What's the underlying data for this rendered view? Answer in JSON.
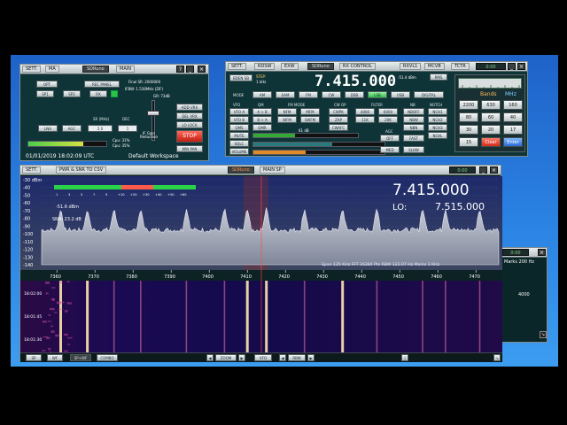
{
  "main_win": {
    "sett": "SETT.",
    "ma": "MA",
    "title": "SDRuno",
    "tab": "MAIN",
    "opt": "OPT",
    "rec_panel": "REC PANEL",
    "sp1": "SP1",
    "sp2": "SP2",
    "rx": "RX",
    "final_sr": "Final SR: 2000000",
    "ifbw": "IFBW: 1.536MHz (ZIF)",
    "gr": "GR: 73dB",
    "add_vrx": "ADD VRX",
    "del_vrx": "DEL VRX",
    "lo_lock": "LO LOCK",
    "stop": "STOP",
    "min_pan": "MIN PAN",
    "lna": "LNA",
    "agc": "AGC",
    "sr_label": "SR (MHz)",
    "sr_value": "2.0",
    "dec_label": "DEC",
    "dec_value": "1",
    "if_gain": "IF Gain Reduction",
    "cpu1": "Cpu: 31%",
    "cpu2": "Cpu: 35%",
    "datetime": "01/01/2019 18:02:09 UTC",
    "workspace": "Default Workspace"
  },
  "rx_win": {
    "sett": "SETT.",
    "rdsw": "RDSW",
    "exw": "EXW",
    "title": "SDRuno",
    "tab": "RX CONTROL",
    "rxvl": "RXVL1",
    "mcv": "MCVB",
    "tctr": "TCTR",
    "band_sel": "BDEN SB",
    "step_label": "STEP:",
    "step_value": "1 kHz",
    "frequency": "7.415.000",
    "signal_db": "-51.4 dBm",
    "rms": "RMS",
    "mode_label": "MODE",
    "modes": [
      "AM",
      "SAM",
      "FM",
      "CW",
      "DSB",
      "LSB",
      "USB",
      "DIGITAL"
    ],
    "vfo_label": "VFO",
    "qm_label": "QM",
    "fm_mode_label": "FM MODE",
    "cw_op_label": "CW OP",
    "filter_label": "FILTER",
    "nb_label": "NB",
    "notch_label": "NOTCH",
    "vfo_a": "VFO A",
    "vfo_b": "VFO B",
    "a_b": "A > B",
    "b_a": "B > A",
    "nfm": "NFM",
    "mfm": "MFM",
    "wfm": "WFM",
    "swfm": "SWFM",
    "cwpk": "CWPK",
    "zap": "ZAP",
    "cwafc": "CWAFC",
    "f_4000": "4000",
    "f_11k": "11K",
    "f_6000": "6000",
    "f_20k": "20K",
    "nb_off": "NBOFF",
    "nbw": "NBW",
    "nbn": "NBN",
    "nch1": "NCH1",
    "nch2": "NCH2",
    "nch3": "NCH3",
    "qms": "QMS",
    "qmr": "QMR",
    "mute": "MUTE",
    "sqlc": "SQLC",
    "volume": "VOLUME",
    "snr": "61 dB",
    "agc_label": "AGC",
    "off": "OFF",
    "fast": "FAST",
    "med": "MED",
    "slow": "SLOW",
    "nchl": "NCHL"
  },
  "keypad": {
    "bands": "Bands",
    "mhz": "MHz",
    "keys": [
      "2200",
      "630",
      "160",
      "80",
      "60",
      "40",
      "30",
      "20",
      "17",
      "15",
      "Clear",
      "Enter"
    ]
  },
  "sp_win": {
    "sett": "SETT.",
    "pwr_snr": "PWR & SNR TO CSV",
    "title": "SDRuno",
    "tab": "MAIN SP",
    "frequency": "7.415.000",
    "lo_label": "LO:",
    "lo_value": "7.515.000",
    "level": "-51.6 dBm",
    "snr": "SNR: 23.2 dB",
    "status": "Span 125 KHz   FFT 16384 Pts   RBW 122.07 Hz   Marks 1 KHz",
    "bottom": {
      "sp": "SP",
      "wf": "WF",
      "sp_wf": "SP+WF",
      "combo": "COMBO",
      "zoom": "ZOOM",
      "vfo": "VFO",
      "rbw": "RBW"
    }
  },
  "side_win": {
    "marks": "Marks 200 Hz",
    "value": "4000"
  },
  "wf_times": [
    "18:02:00",
    "18:01:45",
    "18:01:30"
  ],
  "chart_data": {
    "type": "line",
    "ylabel_unit": "dBm",
    "y_ticks": [
      "-30",
      "-40",
      "-50",
      "-60",
      "-70",
      "-80",
      "-90",
      "-100",
      "-110",
      "-120",
      "-130",
      "-140"
    ],
    "x_ticks": [
      "7360",
      "7370",
      "7380",
      "7390",
      "7400",
      "7410",
      "7420",
      "7430",
      "7440",
      "7450",
      "7460",
      "7470"
    ],
    "signal_peaks_khz": [
      7361,
      7368,
      7375,
      7382,
      7394,
      7404,
      7410,
      7415,
      7425,
      7435,
      7444,
      7456,
      7462,
      7471
    ],
    "smeter_ticks": [
      "1",
      "3",
      "5",
      "7",
      "9",
      "+10",
      "+20",
      "+30",
      "+40",
      "+50",
      "+60"
    ]
  }
}
